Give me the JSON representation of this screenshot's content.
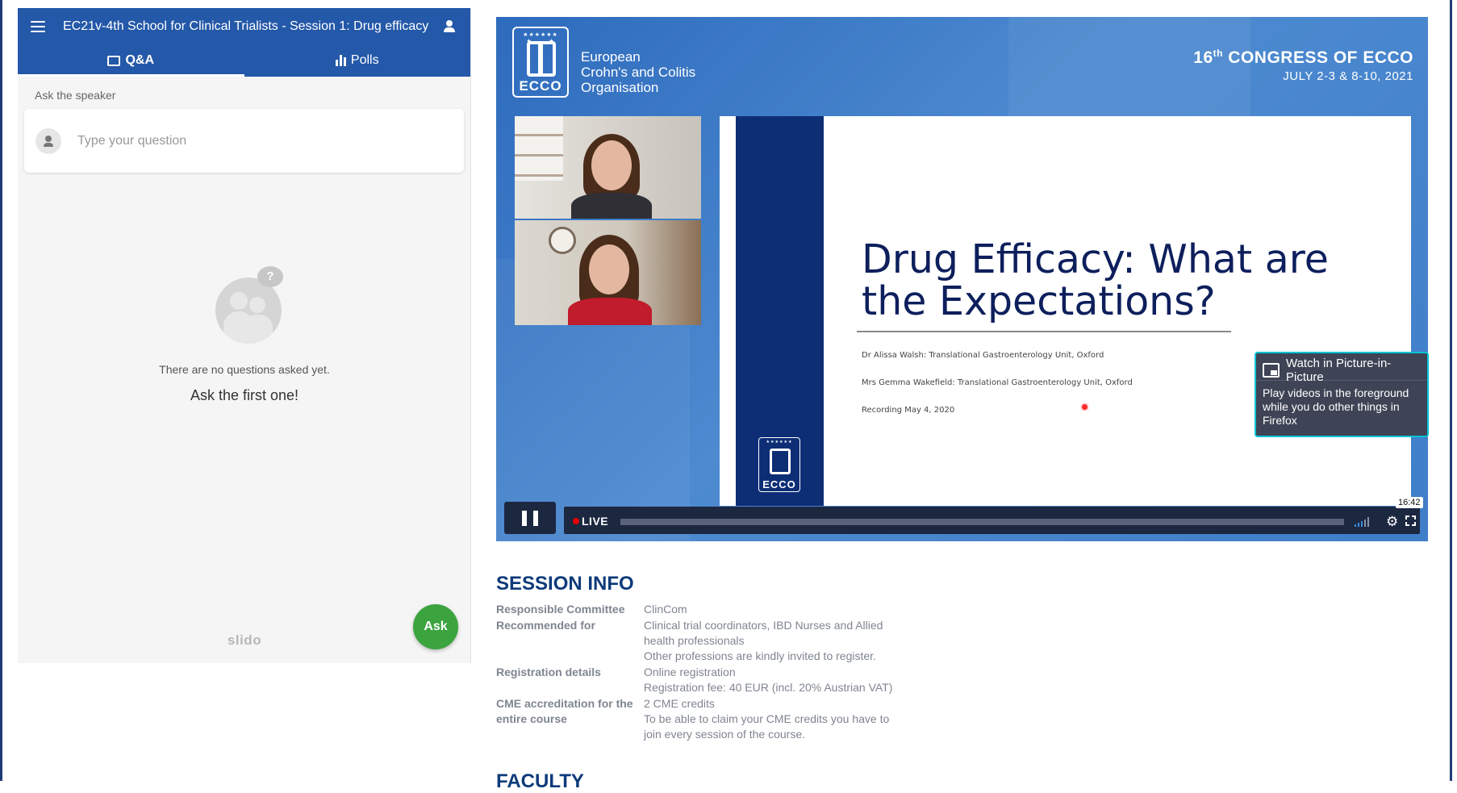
{
  "slido": {
    "title": "EC21v-4th School for Clinical Trialists - Session 1: Drug efficacy",
    "tabs": [
      {
        "label": "Q&A",
        "active": true
      },
      {
        "label": "Polls",
        "active": false
      }
    ],
    "ask_label": "Ask the speaker",
    "question_placeholder": "Type your question",
    "empty_line1": "There are no questions asked yet.",
    "empty_line2": "Ask the first one!",
    "empty_icon_glyph": "?",
    "logo_text": "slido",
    "ask_button": "Ask"
  },
  "video": {
    "org_logo_text": "ECCO",
    "org_name_lines": [
      "European",
      "Crohn's and Colitis",
      "Organisation"
    ],
    "congress_ordinal": "16",
    "congress_sup": "th",
    "congress_title": " CONGRESS OF ECCO",
    "congress_dates": "JULY 2-3 & 8-10, 2021",
    "slide": {
      "title": "Drug Efficacy: What are the Expectations?",
      "lines": [
        "Dr Alissa Walsh: Translational Gastroenterology Unit, Oxford",
        "Mrs Gemma Wakefield: Translational Gastroenterology Unit, Oxford",
        "Recording May 4, 2020"
      ],
      "logo_text": "ECCO"
    },
    "controls": {
      "live_label": "LIVE",
      "time_tooltip": "16:42",
      "progress": 1.0,
      "accent_color": "#3a8dde"
    },
    "pip": {
      "title": "Watch in Picture-in-Picture",
      "description": "Play videos in the foreground while you do other things in Firefox"
    }
  },
  "session": {
    "heading": "SESSION INFO",
    "rows": [
      {
        "label": "Responsible Committee",
        "values": [
          "ClinCom"
        ]
      },
      {
        "label": "Recommended for",
        "values": [
          "Clinical trial coordinators, IBD Nurses and Allied health professionals",
          "Other professions are kindly invited to register."
        ]
      },
      {
        "label": "Registration details",
        "values": [
          "Online registration",
          "Registration fee: 40 EUR (incl. 20% Austrian VAT)"
        ]
      },
      {
        "label": "CME accreditation for the entire course",
        "values": [
          "2 CME credits",
          "To be able to claim your CME credits you have to join every session of the course."
        ]
      }
    ],
    "next_heading": "FACULTY"
  },
  "colors": {
    "slido_header": "#2458a8",
    "ask_button": "#3ba43f",
    "heading": "#0d3a7a",
    "slide_title": "#0d1f5c",
    "pip_border": "#00c5d7"
  }
}
